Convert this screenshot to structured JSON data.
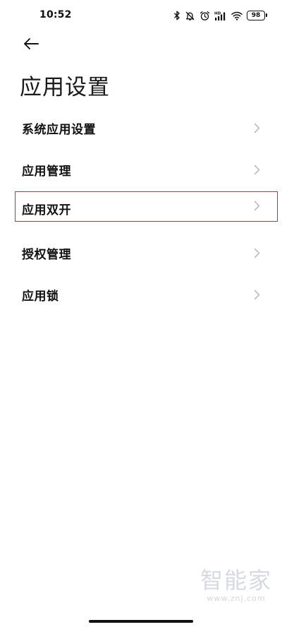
{
  "status_bar": {
    "time": "10:52",
    "icons": [
      "bluetooth-icon",
      "mute-icon",
      "alarm-icon",
      "hd-signal-icon",
      "wifi-icon",
      "battery-icon"
    ],
    "battery_level": "98"
  },
  "header": {
    "back_icon": "arrow-left-icon",
    "title": "应用设置"
  },
  "menu": {
    "items": [
      {
        "label": "系统应用设置",
        "icon": "chevron-right-icon"
      },
      {
        "label": "应用管理",
        "icon": "chevron-right-icon"
      },
      {
        "label": "应用双开",
        "icon": "chevron-right-icon",
        "highlighted": true
      },
      {
        "label": "授权管理",
        "icon": "chevron-right-icon"
      },
      {
        "label": "应用锁",
        "icon": "chevron-right-icon"
      }
    ]
  },
  "colors": {
    "highlight_border": "#c9282d",
    "text": "#111111",
    "chevron": "#b5b5b5",
    "watermark": "#d6dadf"
  },
  "watermark": {
    "text": "智能家",
    "url": "www.znj.com"
  }
}
